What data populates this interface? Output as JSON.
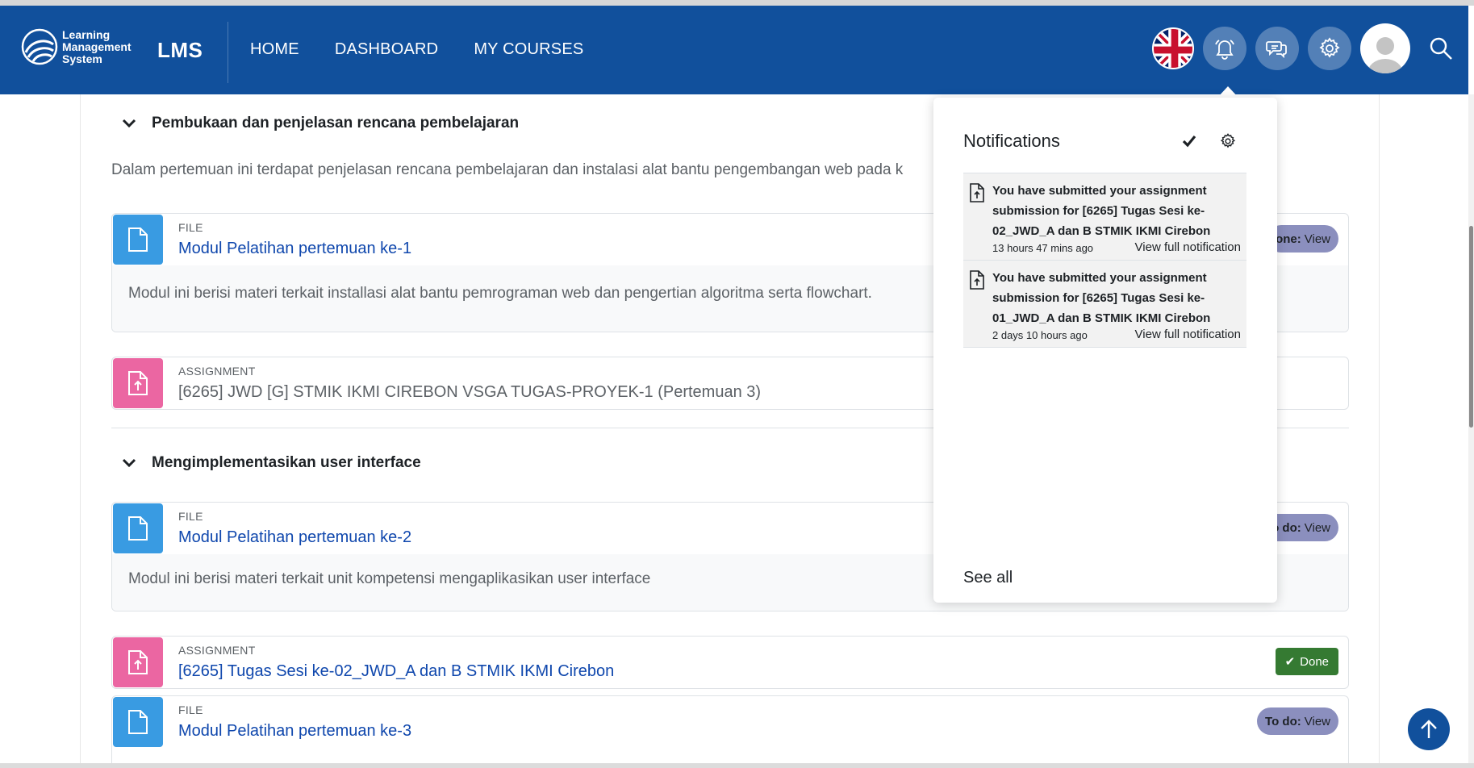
{
  "brand": {
    "logo_lines": [
      "Learning",
      "Management",
      "System"
    ],
    "name": "LMS"
  },
  "nav": {
    "links": [
      "HOME",
      "DASHBOARD",
      "MY COURSES"
    ]
  },
  "header_icons": {
    "language": "uk-flag-icon",
    "notifications": "bell-icon",
    "messages": "chat-icon",
    "settings": "gear-icon",
    "search": "search-icon"
  },
  "sections": [
    {
      "title": "Pembukaan dan penjelasan rencana pembelajaran",
      "description": "Dalam pertemuan ini terdapat penjelasan rencana pembelajaran dan instalasi alat bantu pengembangan web pada k",
      "activities": [
        {
          "type": "FILE",
          "name": "Modul Pelatihan pertemuan ke-1",
          "description": "Modul ini berisi materi terkait installasi alat bantu pemrograman web dan pengertian algoritma serta flowchart.",
          "badge_strong": "one:",
          "badge_text": "View"
        },
        {
          "type": "ASSIGNMENT",
          "name": "[6265] JWD [G] STMIK IKMI CIREBON VSGA TUGAS-PROYEK-1 (Pertemuan 3)"
        }
      ]
    },
    {
      "title": "Mengimplementasikan user interface",
      "activities": [
        {
          "type": "FILE",
          "name": "Modul Pelatihan pertemuan ke-2",
          "description": "Modul ini berisi materi terkait unit kompetensi mengaplikasikan user interface",
          "badge_strong": "o do:",
          "badge_text": "View"
        },
        {
          "type": "ASSIGNMENT",
          "name": "[6265] Tugas Sesi ke-02_JWD_A dan B STMIK IKMI Cirebon",
          "badge_done": "Done"
        },
        {
          "type": "FILE",
          "name": "Modul Pelatihan pertemuan ke-3",
          "badge_strong": "To do:",
          "badge_text": "View"
        }
      ]
    }
  ],
  "notifications": {
    "title": "Notifications",
    "items": [
      {
        "message": "You have submitted your assignment submission for [6265] Tugas Sesi ke-02_JWD_A dan B STMIK IKMI Cirebon",
        "time": "13 hours 47 mins ago",
        "link": "View full notification"
      },
      {
        "message": "You have submitted your assignment submission for [6265] Tugas Sesi ke-01_JWD_A dan B STMIK IKMI Cirebon",
        "time": "2 days 10 hours ago",
        "link": "View full notification"
      }
    ],
    "see_all": "See all"
  },
  "colors": {
    "navbar": "#11509c",
    "file_icon": "#399be2",
    "assignment_icon": "#eb66a2",
    "link": "#0f47ad",
    "done_badge": "#357a32",
    "todo_badge": "#8b8fbe"
  }
}
